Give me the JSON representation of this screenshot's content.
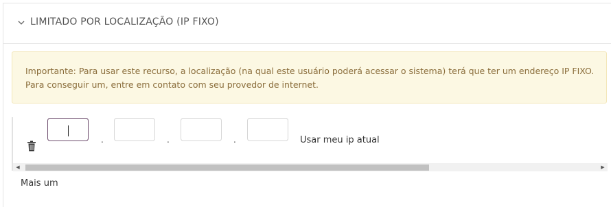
{
  "section": {
    "title": "LIMITADO POR LOCALIZAÇÃO (IP FIXO)",
    "expanded": true
  },
  "notice": {
    "line1": "Importante: Para usar este recurso, a localização (na qual este usuário poderá acessar o sistema) terá que ter um endereço IP FIXO.",
    "line2": "Para conseguir um, entre em contato com seu provedor de internet."
  },
  "ip_row": {
    "octets": [
      "",
      "",
      "",
      ""
    ],
    "separator": ".",
    "use_my_ip_label": "Usar meu ip atual"
  },
  "scrollbar": {
    "left_arrow": "◀",
    "right_arrow": "▶"
  },
  "add_more_label": "Mais um",
  "colors": {
    "notice_bg": "#fcf8e3",
    "notice_text": "#8a6d3b",
    "focused_border": "#6b4a6b"
  }
}
